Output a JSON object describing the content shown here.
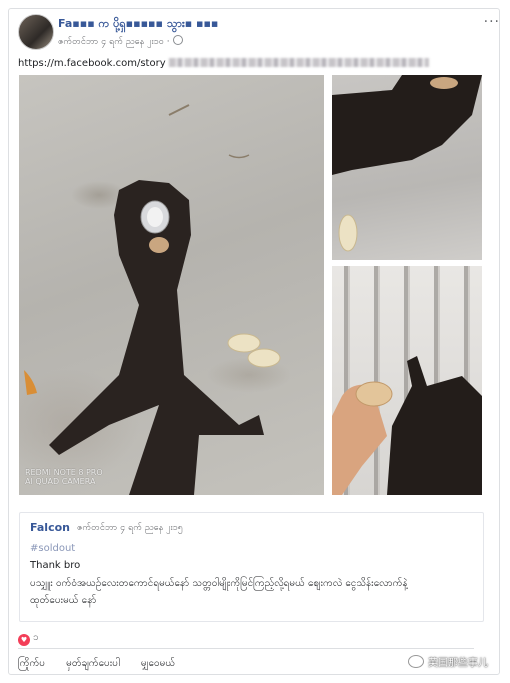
{
  "post": {
    "poster_name": "Fa▪▪▪ က ပို့ရှ▪▪▪▪▪ သွား▪ ▪▪▪",
    "timestamp": "ဇက်တင်ဘာ ၄ ရက် ညနေ ၂း၁၀ ·",
    "more_label": "···",
    "link_url": "https://m.facebook.com/story"
  },
  "photos": {
    "main_watermark_line1": "REDMI NOTE 8 PRO",
    "main_watermark_line2": "AI QUAD CAMERA"
  },
  "comment": {
    "author": "Falcon",
    "timestamp": "ဇက်တင်ဘာ ၄ ရက် ညနေ ၂း၁၅",
    "hashtag": "#soldout",
    "line1": "Thank bro",
    "line2": "ပသျှူး ဝက်ဝံအယဉ်လေးတကောင်ရမယ်နော် သတ္တဝါမျိုးကိုမြင်ကြည့်လို့ရမယ် ဈေးကလဲ ငွေသိန်းလောက်နဲ့",
    "line3": "ထုတ်ပေးမယ် နော်"
  },
  "reactions": {
    "count": "၁"
  },
  "actions": {
    "like": "ကြိုက်ပ",
    "comment": "မှတ်ချက်ပေးပါ",
    "share": "မျှဝေမယ်"
  },
  "watermark": {
    "text": "英国那些事儿"
  }
}
